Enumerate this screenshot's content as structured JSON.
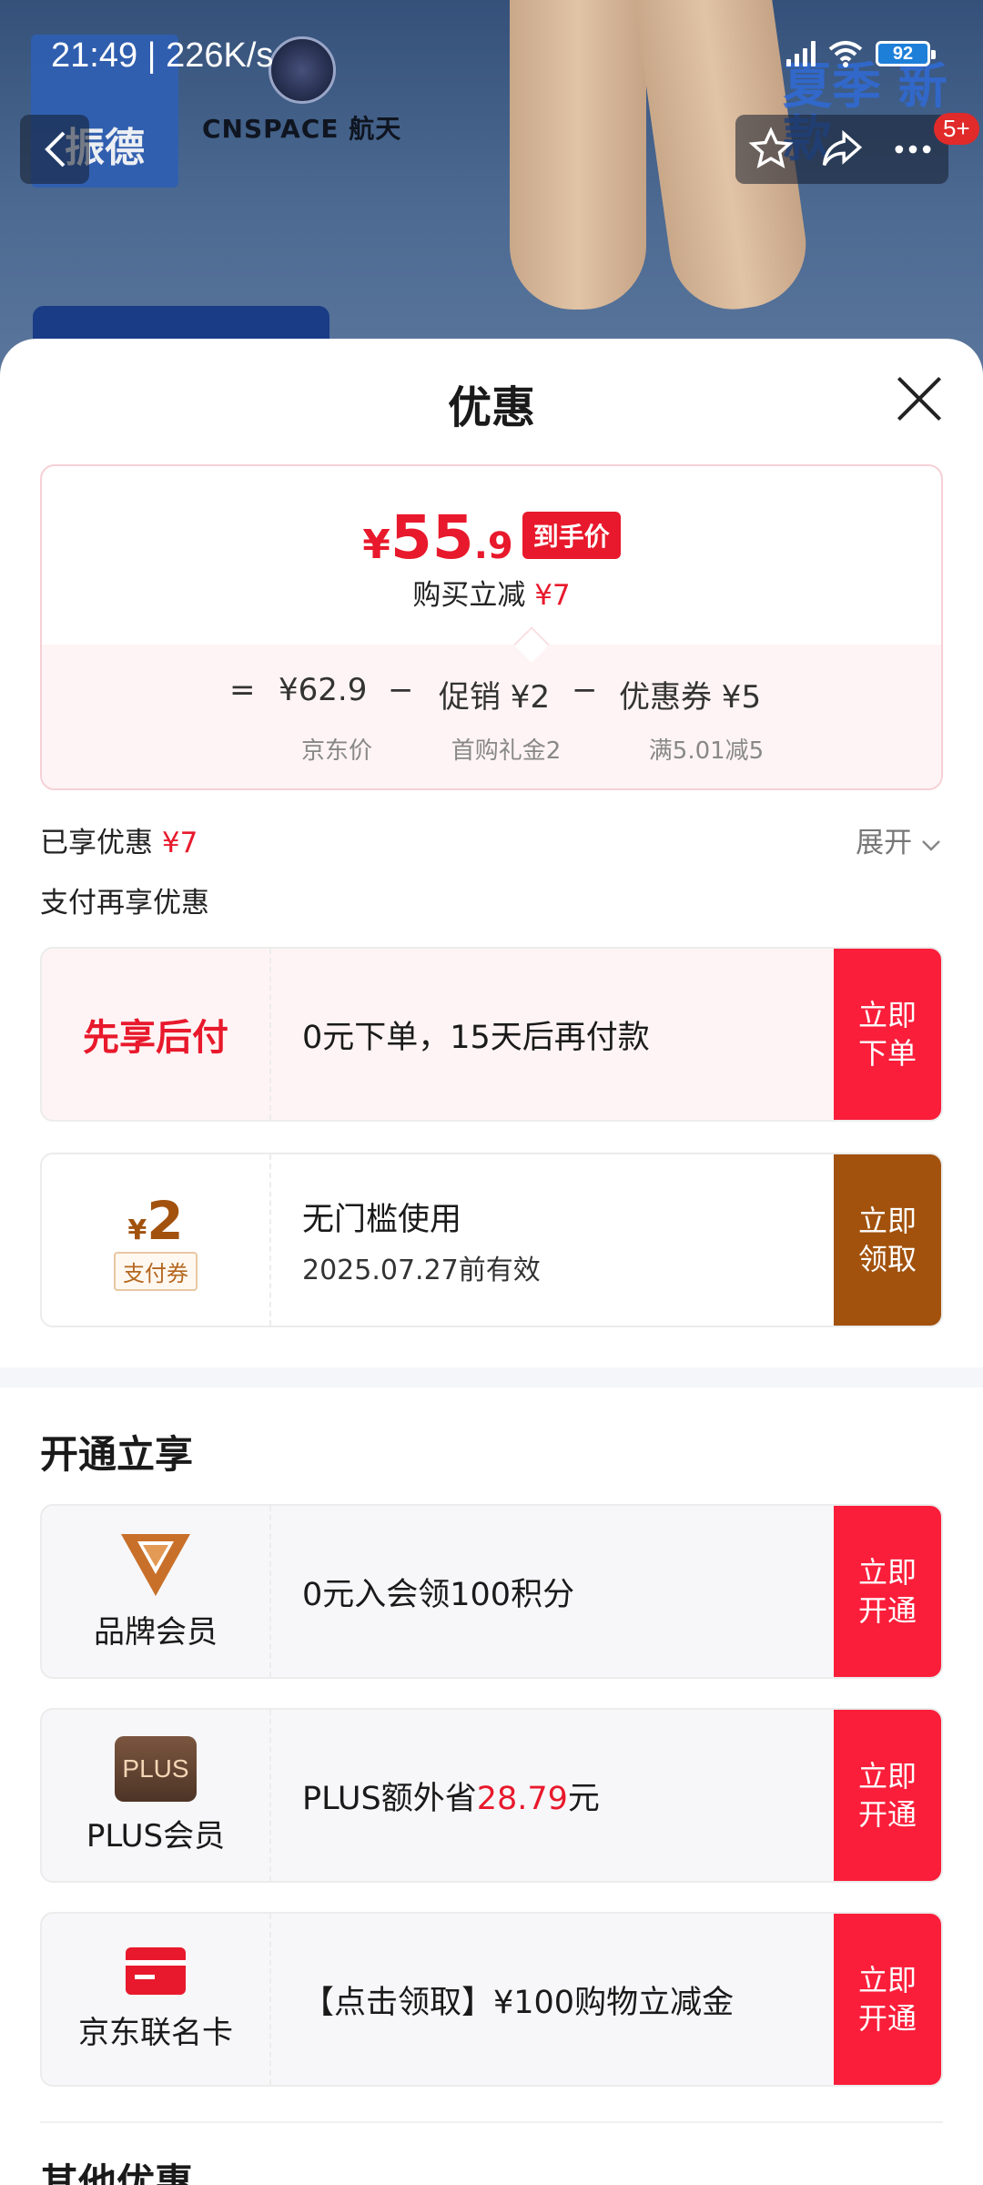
{
  "status_bar": {
    "time": "21:49 | 226K/s",
    "battery": "92"
  },
  "background": {
    "brand_left": "振德",
    "brand_right": "CNSPACE 航天",
    "promo": "夏季 新款"
  },
  "top_nav": {
    "badge": "5+"
  },
  "sheet": {
    "title": "优惠",
    "price": {
      "currency": "¥",
      "integer": "55",
      "decimal": ".9",
      "tag": "到手价",
      "reduce_label": "购买立减",
      "reduce_value": "¥7",
      "eq": "=",
      "base_price": "¥62.9",
      "base_label": "京东价",
      "minus1": "−",
      "promo": "促销 ¥2",
      "promo_label": "首购礼金2",
      "minus2": "−",
      "coupon": "优惠券 ¥5",
      "coupon_label": "满5.01减5"
    },
    "enjoyed_label": "已享优惠",
    "enjoyed_value": "¥7",
    "expand_label": "展开",
    "pay_more_label": "支付再享优惠",
    "offers": [
      {
        "left": "先享后付",
        "text": "0元下单，15天后再付款",
        "btn": "立即下单"
      },
      {
        "amount": "2",
        "currency": "¥",
        "tag": "支付券",
        "text": "无门槛使用",
        "sub": "2025.07.27前有效",
        "btn": "立即领取"
      }
    ],
    "open_title": "开通立享",
    "memberships": [
      {
        "name": "品牌会员",
        "text": "0元入会领100积分",
        "btn": "立即开通"
      },
      {
        "logo": "PLUS",
        "name": "PLUS会员",
        "text_prefix": "PLUS额外省",
        "text_value": "28.79",
        "text_suffix": "元",
        "btn": "立即开通"
      },
      {
        "name": "京东联名卡",
        "text": "【点击领取】¥100购物立减金",
        "btn": "立即开通"
      }
    ],
    "other_title": "其他优惠"
  }
}
